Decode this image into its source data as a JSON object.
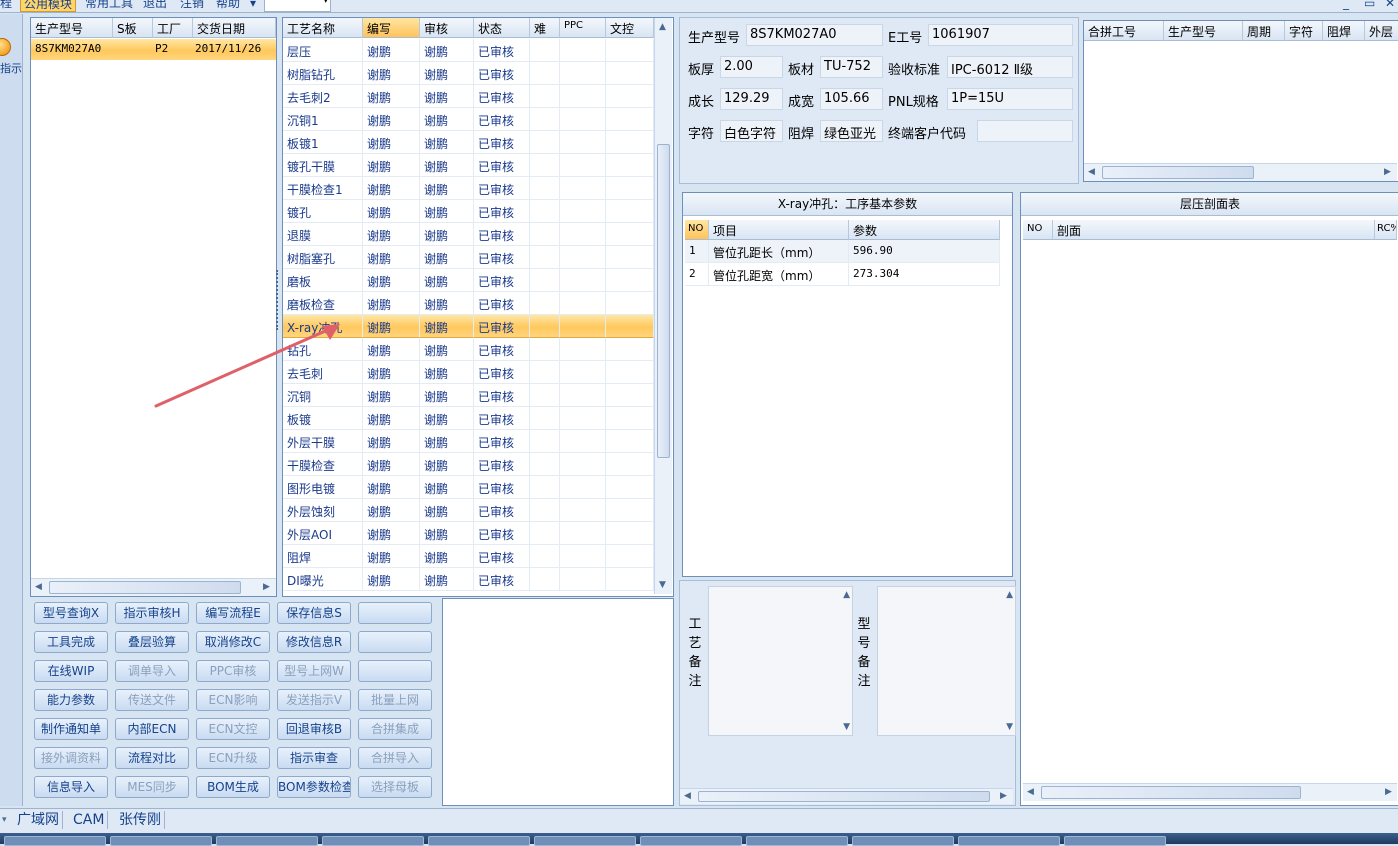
{
  "menu": {
    "items": [
      "程",
      "公用模块",
      "常用工具",
      "退出",
      "注销",
      "帮助"
    ],
    "active_index": 1,
    "combo_value": "",
    "window_controls": [
      "_",
      "▭",
      "✕"
    ]
  },
  "left_strip": {
    "button_label": "指示"
  },
  "model_grid": {
    "columns": [
      "生产型号",
      "S板",
      "工厂",
      "交货日期"
    ],
    "rows": [
      [
        "8S7KM027A0",
        "",
        "P2",
        "2017/11/26"
      ]
    ]
  },
  "process_grid": {
    "columns": [
      "工艺名称",
      "编写",
      "审核",
      "状态",
      "难",
      "PPC",
      "文控"
    ],
    "selected_index": 12,
    "rows": [
      [
        "层压",
        "谢鹏",
        "谢鹏",
        "已审核"
      ],
      [
        "树脂钻孔",
        "谢鹏",
        "谢鹏",
        "已审核"
      ],
      [
        "去毛刺2",
        "谢鹏",
        "谢鹏",
        "已审核"
      ],
      [
        "沉铜1",
        "谢鹏",
        "谢鹏",
        "已审核"
      ],
      [
        "板镀1",
        "谢鹏",
        "谢鹏",
        "已审核"
      ],
      [
        "镀孔干膜",
        "谢鹏",
        "谢鹏",
        "已审核"
      ],
      [
        "干膜检查1",
        "谢鹏",
        "谢鹏",
        "已审核"
      ],
      [
        "镀孔",
        "谢鹏",
        "谢鹏",
        "已审核"
      ],
      [
        "退膜",
        "谢鹏",
        "谢鹏",
        "已审核"
      ],
      [
        "树脂塞孔",
        "谢鹏",
        "谢鹏",
        "已审核"
      ],
      [
        "磨板",
        "谢鹏",
        "谢鹏",
        "已审核"
      ],
      [
        "磨板检查",
        "谢鹏",
        "谢鹏",
        "已审核"
      ],
      [
        "X-ray冲孔",
        "谢鹏",
        "谢鹏",
        "已审核"
      ],
      [
        "钻孔",
        "谢鹏",
        "谢鹏",
        "已审核"
      ],
      [
        "去毛刺",
        "谢鹏",
        "谢鹏",
        "已审核"
      ],
      [
        "沉铜",
        "谢鹏",
        "谢鹏",
        "已审核"
      ],
      [
        "板镀",
        "谢鹏",
        "谢鹏",
        "已审核"
      ],
      [
        "外层干膜",
        "谢鹏",
        "谢鹏",
        "已审核"
      ],
      [
        "干膜检查",
        "谢鹏",
        "谢鹏",
        "已审核"
      ],
      [
        "图形电镀",
        "谢鹏",
        "谢鹏",
        "已审核"
      ],
      [
        "外层蚀刻",
        "谢鹏",
        "谢鹏",
        "已审核"
      ],
      [
        "外层AOI",
        "谢鹏",
        "谢鹏",
        "已审核"
      ],
      [
        "阻焊",
        "谢鹏",
        "谢鹏",
        "已审核"
      ],
      [
        "DI曝光",
        "谢鹏",
        "谢鹏",
        "已审核"
      ]
    ]
  },
  "buttons": [
    [
      {
        "label": "型号查询X",
        "enabled": true
      },
      {
        "label": "指示审核H",
        "enabled": true
      },
      {
        "label": "编写流程E",
        "enabled": true
      },
      {
        "label": "保存信息S",
        "enabled": true
      },
      {
        "label": "",
        "enabled": true
      }
    ],
    [
      {
        "label": "工具完成",
        "enabled": true
      },
      {
        "label": "叠层验算",
        "enabled": true
      },
      {
        "label": "取消修改C",
        "enabled": true
      },
      {
        "label": "修改信息R",
        "enabled": true
      },
      {
        "label": "",
        "enabled": true
      }
    ],
    [
      {
        "label": "在线WIP",
        "enabled": true
      },
      {
        "label": "调单导入",
        "enabled": false
      },
      {
        "label": "PPC审核",
        "enabled": false
      },
      {
        "label": "型号上网W",
        "enabled": false
      },
      {
        "label": "",
        "enabled": true
      }
    ],
    [
      {
        "label": "能力参数",
        "enabled": true
      },
      {
        "label": "传送文件",
        "enabled": false
      },
      {
        "label": "ECN影响",
        "enabled": false
      },
      {
        "label": "发送指示V",
        "enabled": false
      },
      {
        "label": "批量上网",
        "enabled": false
      }
    ],
    [
      {
        "label": "制作通知单",
        "enabled": true
      },
      {
        "label": "内部ECN",
        "enabled": true
      },
      {
        "label": "ECN文控",
        "enabled": false
      },
      {
        "label": "回退审核B",
        "enabled": true
      },
      {
        "label": "合拼集成",
        "enabled": false
      }
    ],
    [
      {
        "label": "接外调资料",
        "enabled": false
      },
      {
        "label": "流程对比",
        "enabled": true
      },
      {
        "label": "ECN升级",
        "enabled": false
      },
      {
        "label": "指示审查",
        "enabled": true
      },
      {
        "label": "合拼导入",
        "enabled": false
      }
    ],
    [
      {
        "label": "信息导入",
        "enabled": true
      },
      {
        "label": "MES同步",
        "enabled": false
      },
      {
        "label": "BOM生成",
        "enabled": true
      },
      {
        "label": "BOM参数检查",
        "enabled": true
      },
      {
        "label": "选择母板",
        "enabled": false
      }
    ]
  ],
  "info": {
    "model_label": "生产型号",
    "model_value": "8S7KM027A0",
    "eno_label": "E工号",
    "eno_value": "1061907",
    "thickness_label": "板厚",
    "thickness_value": "2.00",
    "material_label": "板材",
    "material_value": "TU-752",
    "standard_label": "验收标准",
    "standard_value": "IPC-6012 Ⅱ级",
    "length_label": "成长",
    "length_value": "129.29",
    "width_label": "成宽",
    "width_value": "105.66",
    "pnl_label": "PNL规格",
    "pnl_value": "1P=15U",
    "char_label": "字符",
    "char_value": "白色字符",
    "mask_label": "阻焊",
    "mask_value": "绿色亚光",
    "customer_label": "终端客户代码",
    "customer_value": ""
  },
  "merge_grid": {
    "columns": [
      "合拼工号",
      "生产型号",
      "周期",
      "字符",
      "阻焊",
      "外层"
    ]
  },
  "xray": {
    "title": "X-ray冲孔：工序基本参数",
    "columns": [
      "NO",
      "项目",
      "参数"
    ],
    "rows": [
      [
        "1",
        "管位孔距长（mm）",
        "596.90"
      ],
      [
        "2",
        "管位孔距宽（mm）",
        "273.304"
      ]
    ]
  },
  "layer": {
    "title": "层压剖面表",
    "columns": [
      "NO",
      "剖面",
      "RC%"
    ]
  },
  "remarks": {
    "process_label": "工艺备注",
    "model_label": "型号备注"
  },
  "status": {
    "items": [
      "广域网",
      "CAM",
      "张传刚"
    ]
  },
  "colors": {
    "selection": "#ffc85d",
    "accent": "#15428b",
    "annotation_arrow": "#e0606a"
  }
}
